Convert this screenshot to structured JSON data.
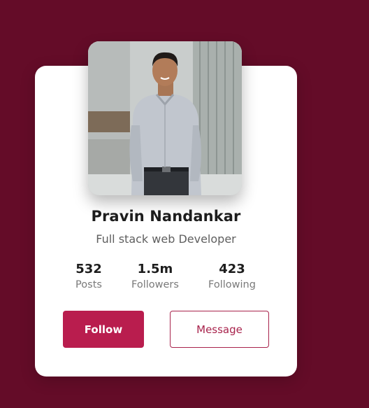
{
  "profile": {
    "name": "Pravin Nandankar",
    "role": "Full stack web Developer",
    "photo_icon": "profile-photo"
  },
  "stats": [
    {
      "value": "532",
      "label": "Posts"
    },
    {
      "value": "1.5m",
      "label": "Followers"
    },
    {
      "value": "423",
      "label": "Following"
    }
  ],
  "actions": {
    "follow_label": "Follow",
    "message_label": "Message"
  },
  "colors": {
    "background": "#640c28",
    "card": "#ffffff",
    "accent": "#b91d4e",
    "outline": "#a8234c"
  }
}
